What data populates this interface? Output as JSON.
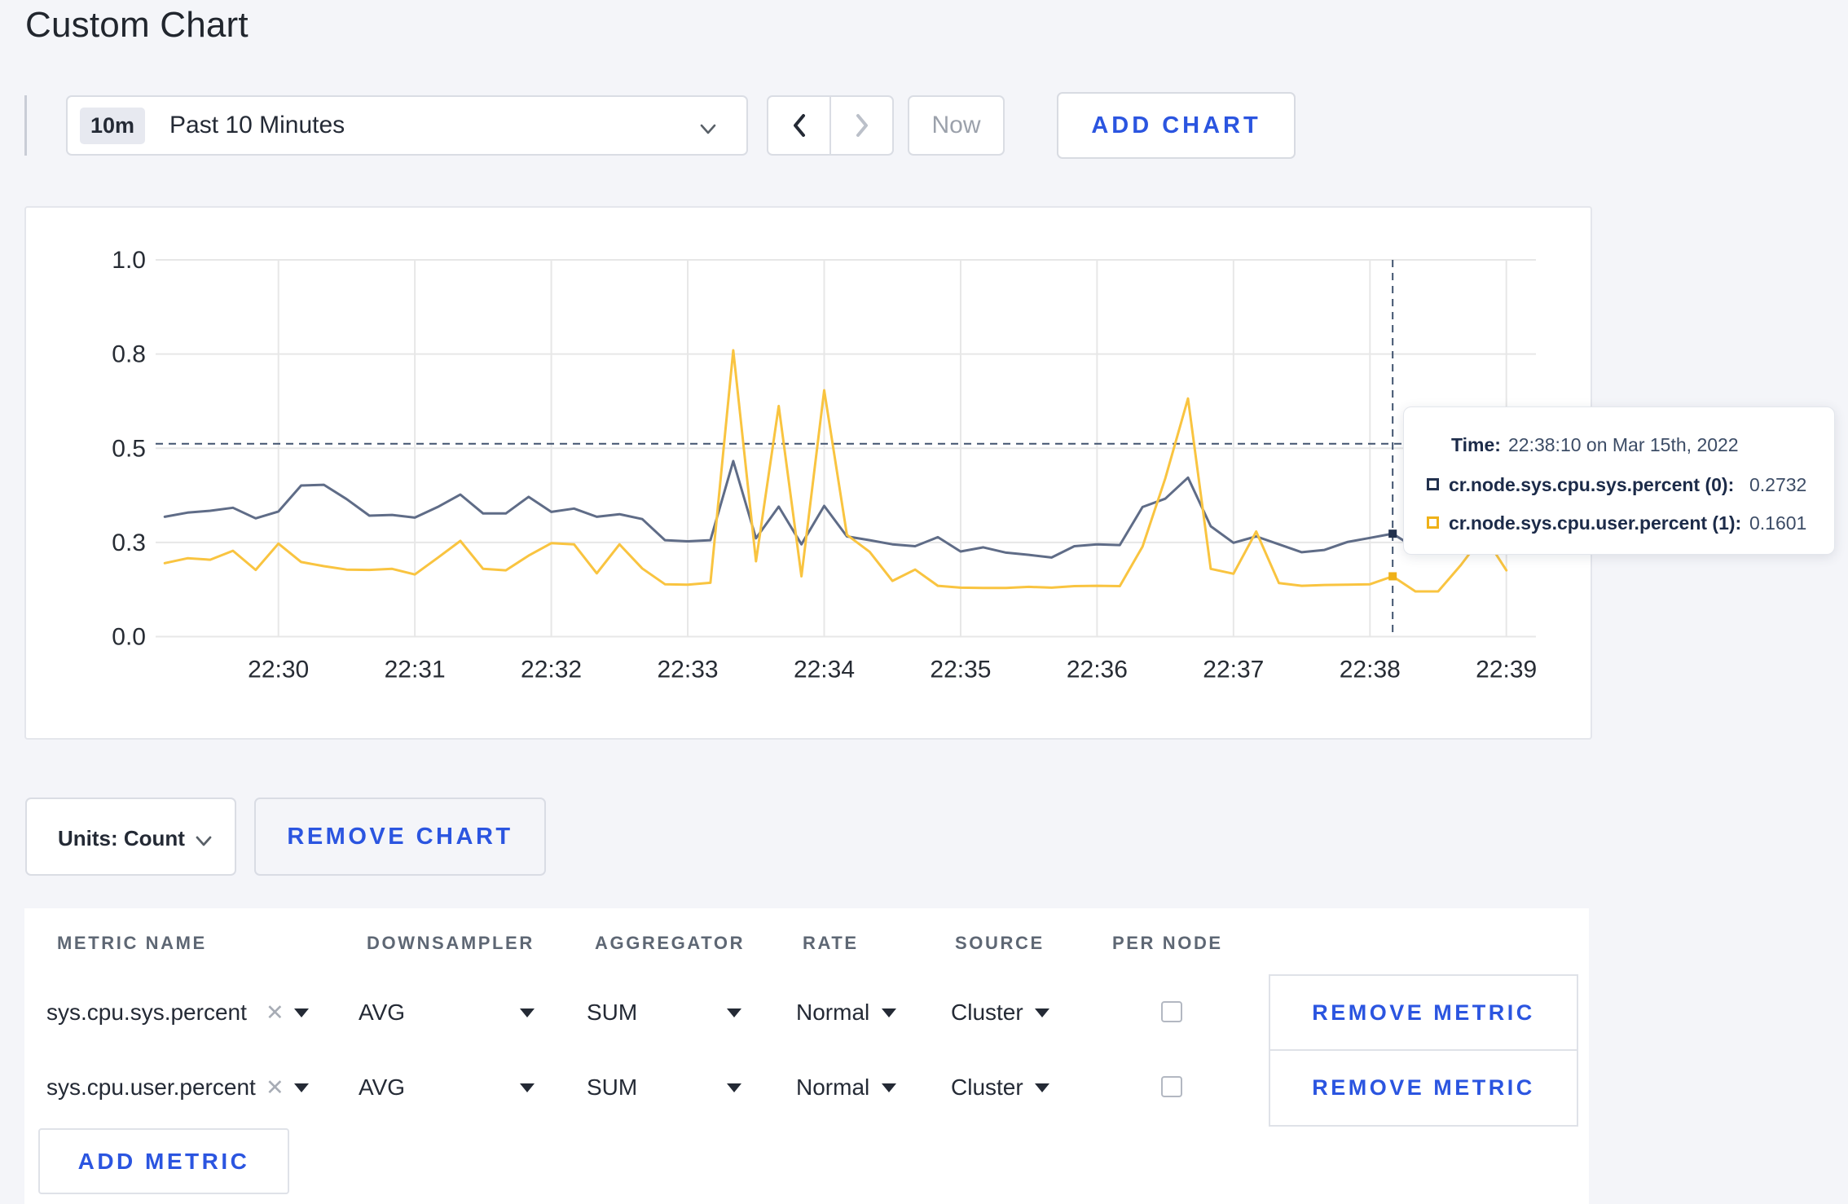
{
  "page": {
    "title": "Custom Chart",
    "background": "#F4F5F9",
    "accent_blue": "#2B55E0"
  },
  "toolbar": {
    "time_range": {
      "badge": "10m",
      "label": "Past 10 Minutes"
    },
    "now_label": "Now",
    "add_chart_label": "ADD CHART"
  },
  "chart_data": {
    "type": "line",
    "title": "",
    "xlabel": "",
    "ylabel": "",
    "grid": true,
    "legend_position": "tooltip",
    "y_axis": {
      "range": [
        0,
        1
      ],
      "ticks": [
        {
          "value": 0,
          "label": "0.0"
        },
        {
          "value": 0.25,
          "label": "0.3"
        },
        {
          "value": 0.5,
          "label": "0.5"
        },
        {
          "value": 0.75,
          "label": "0.8"
        },
        {
          "value": 1,
          "label": "1.0"
        }
      ]
    },
    "x_axis": {
      "domain": [
        "22:29:06",
        "22:39:13"
      ],
      "ticks": [
        "22:30",
        "22:31",
        "22:32",
        "22:33",
        "22:34",
        "22:35",
        "22:36",
        "22:37",
        "22:38",
        "22:39"
      ]
    },
    "x": [
      "22:29:10",
      "22:29:20",
      "22:29:30",
      "22:29:40",
      "22:29:50",
      "22:30:00",
      "22:30:10",
      "22:30:20",
      "22:30:30",
      "22:30:40",
      "22:30:50",
      "22:31:00",
      "22:31:10",
      "22:31:20",
      "22:31:30",
      "22:31:40",
      "22:31:50",
      "22:32:00",
      "22:32:10",
      "22:32:20",
      "22:32:30",
      "22:32:40",
      "22:32:50",
      "22:33:00",
      "22:33:10",
      "22:33:20",
      "22:33:30",
      "22:33:40",
      "22:33:50",
      "22:34:00",
      "22:34:10",
      "22:34:20",
      "22:34:30",
      "22:34:40",
      "22:34:50",
      "22:35:00",
      "22:35:10",
      "22:35:20",
      "22:35:30",
      "22:35:40",
      "22:35:50",
      "22:36:00",
      "22:36:10",
      "22:36:20",
      "22:36:30",
      "22:36:40",
      "22:36:50",
      "22:37:00",
      "22:37:10",
      "22:37:20",
      "22:37:30",
      "22:37:40",
      "22:37:50",
      "22:38:00",
      "22:38:10",
      "22:38:20",
      "22:38:30",
      "22:38:40",
      "22:38:50",
      "22:39:00"
    ],
    "series": [
      {
        "name": "cr.node.sys.cpu.sys.percent (0)",
        "color": "#5F6C87",
        "marker_color": "#22314E",
        "values": [
          0.318,
          0.329,
          0.334,
          0.342,
          0.314,
          0.332,
          0.401,
          0.403,
          0.365,
          0.321,
          0.323,
          0.316,
          0.344,
          0.377,
          0.327,
          0.327,
          0.371,
          0.331,
          0.34,
          0.318,
          0.325,
          0.312,
          0.256,
          0.253,
          0.256,
          0.466,
          0.261,
          0.345,
          0.245,
          0.347,
          0.266,
          0.256,
          0.245,
          0.24,
          0.264,
          0.226,
          0.237,
          0.223,
          0.217,
          0.21,
          0.24,
          0.245,
          0.243,
          0.344,
          0.366,
          0.422,
          0.293,
          0.249,
          0.266,
          0.245,
          0.224,
          0.23,
          0.251,
          0.262,
          0.2732,
          0.235,
          0.27,
          0.3,
          0.28,
          0.3
        ]
      },
      {
        "name": "cr.node.sys.cpu.user.percent (1)",
        "color": "#F9C440",
        "marker_color": "#EFB118",
        "values": [
          0.195,
          0.208,
          0.204,
          0.228,
          0.177,
          0.247,
          0.198,
          0.187,
          0.178,
          0.177,
          0.18,
          0.165,
          0.209,
          0.254,
          0.18,
          0.176,
          0.215,
          0.248,
          0.245,
          0.168,
          0.245,
          0.181,
          0.139,
          0.138,
          0.143,
          0.76,
          0.2,
          0.612,
          0.16,
          0.654,
          0.27,
          0.225,
          0.148,
          0.178,
          0.135,
          0.13,
          0.129,
          0.129,
          0.132,
          0.13,
          0.134,
          0.135,
          0.134,
          0.239,
          0.42,
          0.632,
          0.18,
          0.167,
          0.279,
          0.142,
          0.135,
          0.137,
          0.138,
          0.139,
          0.1601,
          0.12,
          0.12,
          0.19,
          0.27,
          0.176
        ]
      }
    ],
    "crosshair": {
      "time": "22:38:10",
      "h_value": 0.512
    },
    "tooltip": {
      "time_label": "Time:",
      "time_value": "22:38:10 on Mar 15th, 2022",
      "rows": [
        {
          "label": "cr.node.sys.cpu.sys.percent (0):",
          "value": "0.2732"
        },
        {
          "label": "cr.node.sys.cpu.user.percent (1):",
          "value": "0.1601"
        }
      ]
    }
  },
  "units_bar": {
    "units_label": "Units: Count",
    "remove_chart_label": "REMOVE CHART"
  },
  "metrics_table": {
    "headers": [
      "METRIC NAME",
      "DOWNSAMPLER",
      "AGGREGATOR",
      "RATE",
      "SOURCE",
      "PER NODE"
    ],
    "rows": [
      {
        "metric_name": "sys.cpu.sys.percent",
        "downsampler": "AVG",
        "aggregator": "SUM",
        "rate": "Normal",
        "source": "Cluster",
        "per_node_checked": false,
        "remove_label": "REMOVE METRIC"
      },
      {
        "metric_name": "sys.cpu.user.percent",
        "downsampler": "AVG",
        "aggregator": "SUM",
        "rate": "Normal",
        "source": "Cluster",
        "per_node_checked": false,
        "remove_label": "REMOVE METRIC"
      }
    ],
    "add_metric_label": "ADD METRIC"
  }
}
